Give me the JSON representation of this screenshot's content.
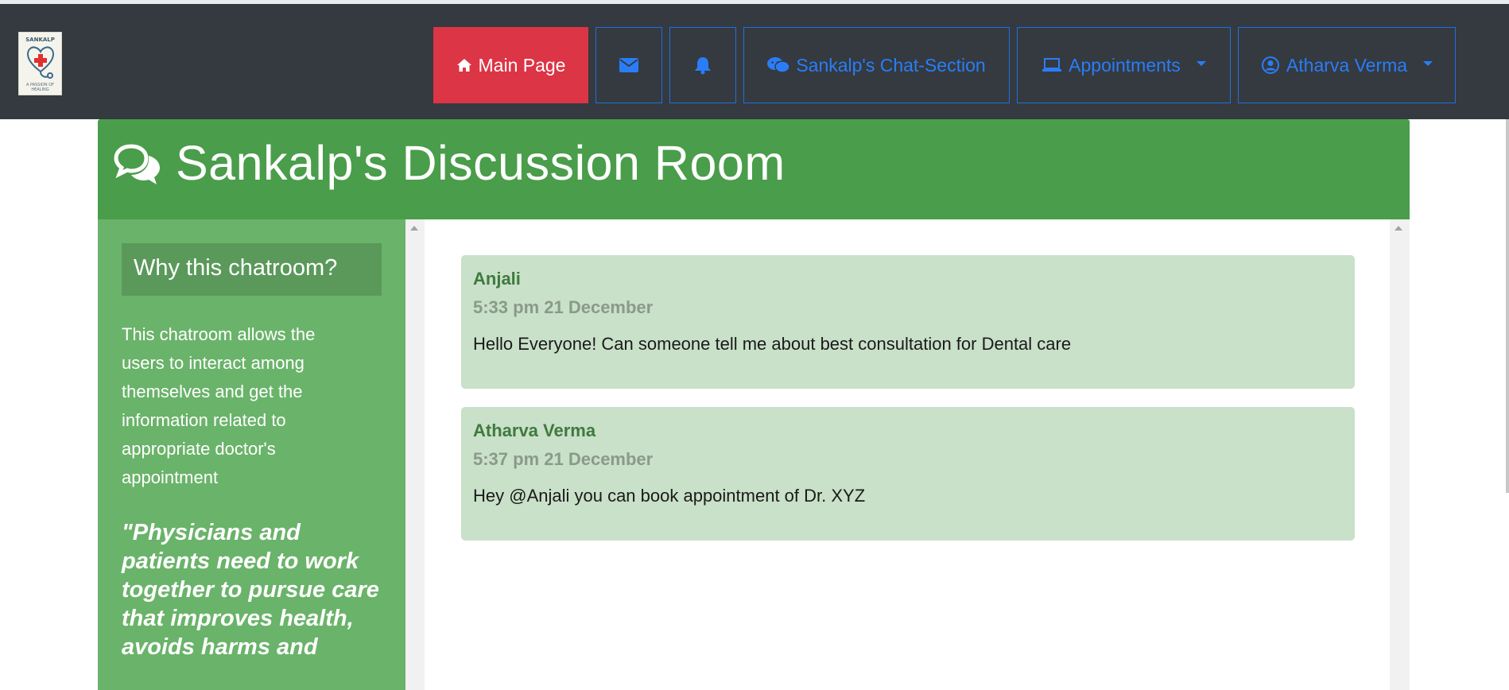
{
  "logo": {
    "top_text": "SANKALP",
    "bottom_text": "A PASSION OF HEALING"
  },
  "navbar": {
    "main_page_label": "Main Page",
    "messages_icon": "envelope-icon",
    "notifications_icon": "bell-icon",
    "chat_section_label": "Sankalp's Chat-Section",
    "appointments_label": "Appointments",
    "user_label": "Atharva Verma"
  },
  "room": {
    "title": "Sankalp's Discussion Room",
    "icon": "comments-icon"
  },
  "sidebar": {
    "heading": "Why this chatroom?",
    "description": "This chatroom allows the users to interact among themselves and get the information related to appropriate doctor's appointment",
    "quote": "\"Physicians and patients need to work together to pursue care that improves health, avoids harms and"
  },
  "messages": [
    {
      "author": "Anjali",
      "time": "5:33 pm 21 December",
      "text": "Hello Everyone! Can someone tell me about best consultation for Dental care"
    },
    {
      "author": "Atharva Verma",
      "time": "5:37 pm 21 December",
      "text": "Hey @Anjali you can book appointment of Dr. XYZ"
    }
  ],
  "colors": {
    "navbar": "#343a40",
    "active_nav": "#dc3545",
    "nav_link": "#2a7df7",
    "header_green": "#4a9d4a",
    "sidebar_green": "#6ab36a",
    "message_bg": "#c9e0c9"
  }
}
